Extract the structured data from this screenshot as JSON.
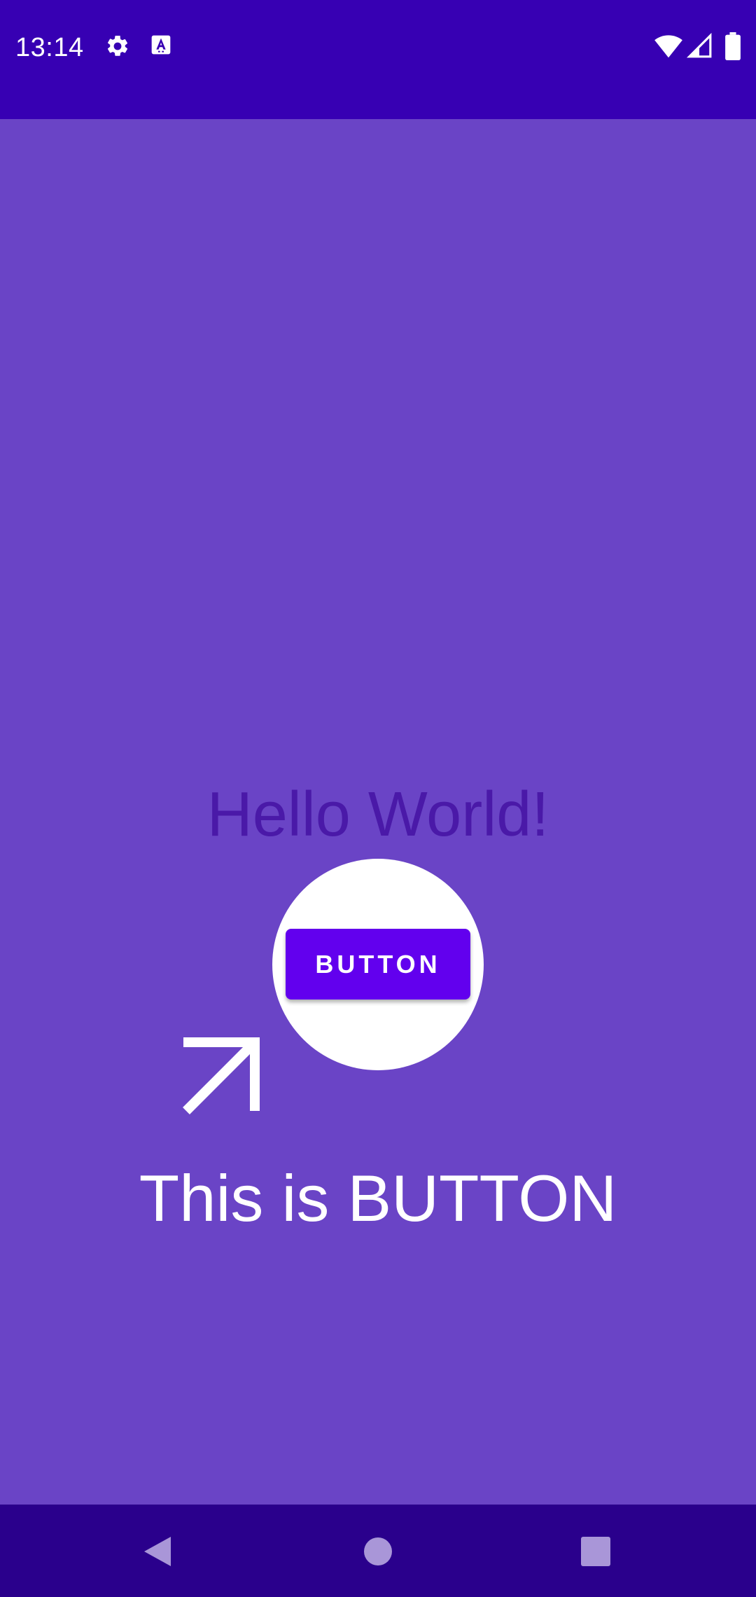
{
  "status_bar": {
    "time": "13:14",
    "icons_left": [
      "gear-icon",
      "text-a-icon"
    ],
    "icons_right": [
      "wifi-icon",
      "signal-icon",
      "battery-icon"
    ],
    "color": "#3700b3"
  },
  "main": {
    "background_color": "#6a44c6",
    "hello_text": "Hello World!",
    "button_label": "BUTTON",
    "button_color": "#6200ee",
    "caption": "This is BUTTON",
    "pointer_icon": "arrow-up-right-icon"
  },
  "nav_bar": {
    "buttons": [
      "back-icon",
      "home-icon",
      "recents-icon"
    ],
    "color": "#2a008c"
  }
}
